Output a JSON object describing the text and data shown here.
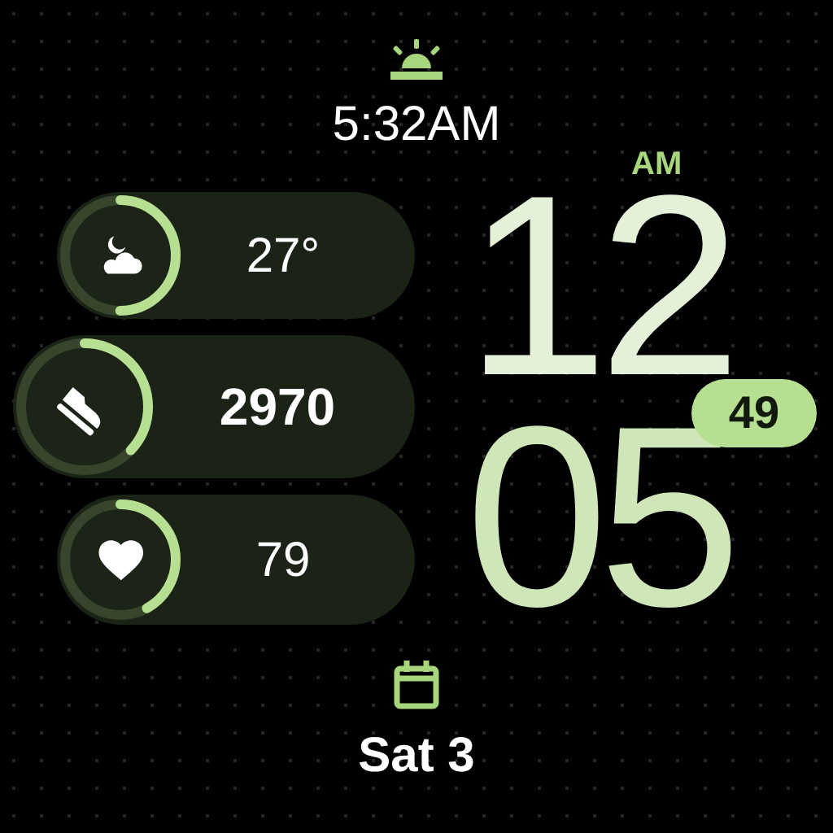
{
  "sunrise": {
    "time": "5:32AM"
  },
  "complications": [
    {
      "kind": "weather",
      "value": "27°",
      "level": 0.5
    },
    {
      "kind": "steps",
      "value": "2970",
      "level": 0.37
    },
    {
      "kind": "heart",
      "value": "79",
      "level": 0.42
    }
  ],
  "clock": {
    "period": "AM",
    "hours": "12",
    "minutes": "05",
    "seconds": "49"
  },
  "date": {
    "text": "Sat 3"
  }
}
